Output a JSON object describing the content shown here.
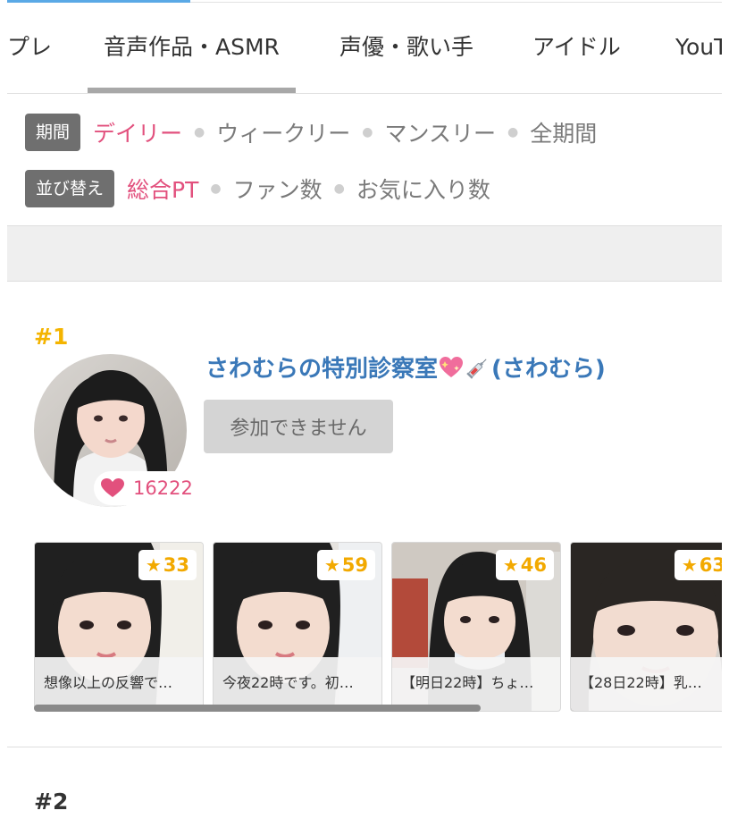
{
  "tabs": [
    "プレ",
    "音声作品・ASMR",
    "声優・歌い手",
    "アイドル",
    "YouT"
  ],
  "active_tab": "音声作品・ASMR",
  "filters": {
    "period_label": "期間",
    "period_options": [
      "デイリー",
      "ウィークリー",
      "マンスリー",
      "全期間"
    ],
    "period_selected": "デイリー",
    "sort_label": "並び替え",
    "sort_options": [
      "総合PT",
      "ファン数",
      "お気に入り数"
    ],
    "sort_selected": "総合PT"
  },
  "entries": [
    {
      "rank": "#1",
      "title_before_icons": "さわむらの特別診察室",
      "title_after_icons": " (さわむら)",
      "title_icons": [
        "sparkling-heart-icon",
        "syringe-icon"
      ],
      "fans": "16222",
      "join_label": "参加できません",
      "cards": [
        {
          "stars": "33",
          "caption": "想像以上の反響で…"
        },
        {
          "stars": "59",
          "caption": "今夜22時です。初…"
        },
        {
          "stars": "46",
          "caption": "【明日22時】ちょ…"
        },
        {
          "stars": "63",
          "caption": "【28日22時】乳…"
        }
      ]
    },
    {
      "rank": "#2"
    }
  ],
  "colors": {
    "accent_pink": "#e2507d",
    "link_blue": "#3a78b8",
    "rank_gold": "#f4b400",
    "chip_gray": "#6f6f6f",
    "top_accent": "#5aa9e6"
  }
}
